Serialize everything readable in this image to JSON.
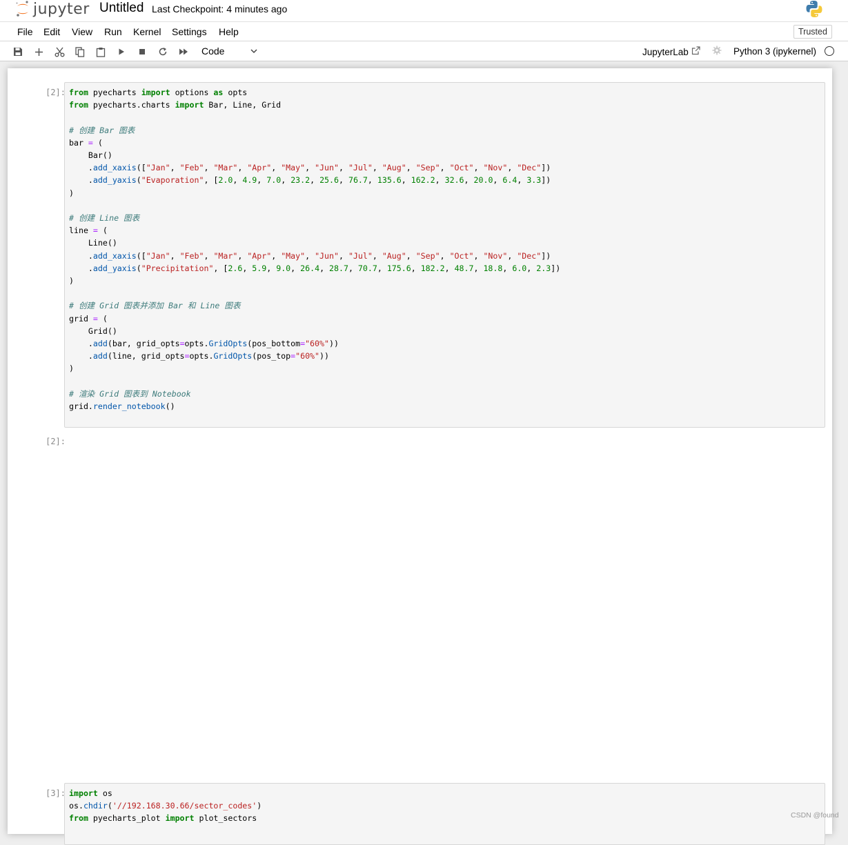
{
  "header": {
    "logo_text": "jupyter",
    "notebook_title": "Untitled",
    "checkpoint_label": "Last Checkpoint:",
    "checkpoint_time": "4 minutes ago"
  },
  "menubar": {
    "items": [
      "File",
      "Edit",
      "View",
      "Run",
      "Kernel",
      "Settings",
      "Help"
    ],
    "trusted_label": "Trusted"
  },
  "toolbar": {
    "icons": [
      "save-icon",
      "add-cell-icon",
      "cut-icon",
      "copy-icon",
      "paste-icon",
      "run-icon",
      "stop-icon",
      "restart-icon",
      "fast-forward-icon"
    ],
    "cell_type": "Code",
    "jupyterlab_label": "JupyterLab",
    "kernel_name": "Python 3 (ipykernel)"
  },
  "cells": [
    {
      "prompt": "[2]:",
      "lines": [
        [
          [
            "kw",
            "from"
          ],
          [
            "t",
            " pyecharts "
          ],
          [
            "kw",
            "import"
          ],
          [
            "t",
            " options "
          ],
          [
            "kw",
            "as"
          ],
          [
            "t",
            " opts"
          ]
        ],
        [
          [
            "kw",
            "from"
          ],
          [
            "t",
            " pyecharts.charts "
          ],
          [
            "kw",
            "import"
          ],
          [
            "t",
            " Bar, Line, Grid"
          ]
        ],
        [],
        [
          [
            "cm",
            "# 创建 Bar 图表"
          ]
        ],
        [
          [
            "t",
            "bar "
          ],
          [
            "op",
            "="
          ],
          [
            "t",
            " ("
          ]
        ],
        [
          [
            "t",
            "    Bar()"
          ]
        ],
        [
          [
            "t",
            "    ."
          ],
          [
            "fn",
            "add_xaxis"
          ],
          [
            "t",
            "(["
          ],
          [
            "st",
            "\"Jan\""
          ],
          [
            "t",
            ", "
          ],
          [
            "st",
            "\"Feb\""
          ],
          [
            "t",
            ", "
          ],
          [
            "st",
            "\"Mar\""
          ],
          [
            "t",
            ", "
          ],
          [
            "st",
            "\"Apr\""
          ],
          [
            "t",
            ", "
          ],
          [
            "st",
            "\"May\""
          ],
          [
            "t",
            ", "
          ],
          [
            "st",
            "\"Jun\""
          ],
          [
            "t",
            ", "
          ],
          [
            "st",
            "\"Jul\""
          ],
          [
            "t",
            ", "
          ],
          [
            "st",
            "\"Aug\""
          ],
          [
            "t",
            ", "
          ],
          [
            "st",
            "\"Sep\""
          ],
          [
            "t",
            ", "
          ],
          [
            "st",
            "\"Oct\""
          ],
          [
            "t",
            ", "
          ],
          [
            "st",
            "\"Nov\""
          ],
          [
            "t",
            ", "
          ],
          [
            "st",
            "\"Dec\""
          ],
          [
            "t",
            "])"
          ]
        ],
        [
          [
            "t",
            "    ."
          ],
          [
            "fn",
            "add_yaxis"
          ],
          [
            "t",
            "("
          ],
          [
            "st",
            "\"Evaporation\""
          ],
          [
            "t",
            ", ["
          ],
          [
            "nm",
            "2.0"
          ],
          [
            "t",
            ", "
          ],
          [
            "nm",
            "4.9"
          ],
          [
            "t",
            ", "
          ],
          [
            "nm",
            "7.0"
          ],
          [
            "t",
            ", "
          ],
          [
            "nm",
            "23.2"
          ],
          [
            "t",
            ", "
          ],
          [
            "nm",
            "25.6"
          ],
          [
            "t",
            ", "
          ],
          [
            "nm",
            "76.7"
          ],
          [
            "t",
            ", "
          ],
          [
            "nm",
            "135.6"
          ],
          [
            "t",
            ", "
          ],
          [
            "nm",
            "162.2"
          ],
          [
            "t",
            ", "
          ],
          [
            "nm",
            "32.6"
          ],
          [
            "t",
            ", "
          ],
          [
            "nm",
            "20.0"
          ],
          [
            "t",
            ", "
          ],
          [
            "nm",
            "6.4"
          ],
          [
            "t",
            ", "
          ],
          [
            "nm",
            "3.3"
          ],
          [
            "t",
            "])"
          ]
        ],
        [
          [
            "t",
            ")"
          ]
        ],
        [],
        [
          [
            "cm",
            "# 创建 Line 图表"
          ]
        ],
        [
          [
            "t",
            "line "
          ],
          [
            "op",
            "="
          ],
          [
            "t",
            " ("
          ]
        ],
        [
          [
            "t",
            "    Line()"
          ]
        ],
        [
          [
            "t",
            "    ."
          ],
          [
            "fn",
            "add_xaxis"
          ],
          [
            "t",
            "(["
          ],
          [
            "st",
            "\"Jan\""
          ],
          [
            "t",
            ", "
          ],
          [
            "st",
            "\"Feb\""
          ],
          [
            "t",
            ", "
          ],
          [
            "st",
            "\"Mar\""
          ],
          [
            "t",
            ", "
          ],
          [
            "st",
            "\"Apr\""
          ],
          [
            "t",
            ", "
          ],
          [
            "st",
            "\"May\""
          ],
          [
            "t",
            ", "
          ],
          [
            "st",
            "\"Jun\""
          ],
          [
            "t",
            ", "
          ],
          [
            "st",
            "\"Jul\""
          ],
          [
            "t",
            ", "
          ],
          [
            "st",
            "\"Aug\""
          ],
          [
            "t",
            ", "
          ],
          [
            "st",
            "\"Sep\""
          ],
          [
            "t",
            ", "
          ],
          [
            "st",
            "\"Oct\""
          ],
          [
            "t",
            ", "
          ],
          [
            "st",
            "\"Nov\""
          ],
          [
            "t",
            ", "
          ],
          [
            "st",
            "\"Dec\""
          ],
          [
            "t",
            "])"
          ]
        ],
        [
          [
            "t",
            "    ."
          ],
          [
            "fn",
            "add_yaxis"
          ],
          [
            "t",
            "("
          ],
          [
            "st",
            "\"Precipitation\""
          ],
          [
            "t",
            ", ["
          ],
          [
            "nm",
            "2.6"
          ],
          [
            "t",
            ", "
          ],
          [
            "nm",
            "5.9"
          ],
          [
            "t",
            ", "
          ],
          [
            "nm",
            "9.0"
          ],
          [
            "t",
            ", "
          ],
          [
            "nm",
            "26.4"
          ],
          [
            "t",
            ", "
          ],
          [
            "nm",
            "28.7"
          ],
          [
            "t",
            ", "
          ],
          [
            "nm",
            "70.7"
          ],
          [
            "t",
            ", "
          ],
          [
            "nm",
            "175.6"
          ],
          [
            "t",
            ", "
          ],
          [
            "nm",
            "182.2"
          ],
          [
            "t",
            ", "
          ],
          [
            "nm",
            "48.7"
          ],
          [
            "t",
            ", "
          ],
          [
            "nm",
            "18.8"
          ],
          [
            "t",
            ", "
          ],
          [
            "nm",
            "6.0"
          ],
          [
            "t",
            ", "
          ],
          [
            "nm",
            "2.3"
          ],
          [
            "t",
            "])"
          ]
        ],
        [
          [
            "t",
            ")"
          ]
        ],
        [],
        [
          [
            "cm",
            "# 创建 Grid 图表并添加 Bar 和 Line 图表"
          ]
        ],
        [
          [
            "t",
            "grid "
          ],
          [
            "op",
            "="
          ],
          [
            "t",
            " ("
          ]
        ],
        [
          [
            "t",
            "    Grid()"
          ]
        ],
        [
          [
            "t",
            "    ."
          ],
          [
            "fn",
            "add"
          ],
          [
            "t",
            "(bar, grid_opts"
          ],
          [
            "op",
            "="
          ],
          [
            "t",
            "opts."
          ],
          [
            "fn",
            "GridOpts"
          ],
          [
            "t",
            "(pos_bottom"
          ],
          [
            "op",
            "="
          ],
          [
            "st",
            "\"60%\""
          ],
          [
            "t",
            "))"
          ]
        ],
        [
          [
            "t",
            "    ."
          ],
          [
            "fn",
            "add"
          ],
          [
            "t",
            "(line, grid_opts"
          ],
          [
            "op",
            "="
          ],
          [
            "t",
            "opts."
          ],
          [
            "fn",
            "GridOpts"
          ],
          [
            "t",
            "(pos_top"
          ],
          [
            "op",
            "="
          ],
          [
            "st",
            "\"60%\""
          ],
          [
            "t",
            "))"
          ]
        ],
        [
          [
            "t",
            ")"
          ]
        ],
        [],
        [
          [
            "cm",
            "# 渲染 Grid 图表到 Notebook"
          ]
        ],
        [
          [
            "t",
            "grid."
          ],
          [
            "fn",
            "render_notebook"
          ],
          [
            "t",
            "()"
          ]
        ]
      ]
    },
    {
      "prompt": "[3]:",
      "lines": [
        [
          [
            "kw",
            "import"
          ],
          [
            "t",
            " os"
          ]
        ],
        [
          [
            "t",
            "os."
          ],
          [
            "fn",
            "chdir"
          ],
          [
            "t",
            "("
          ],
          [
            "st",
            "'//192.168.30.66/sector_codes'"
          ],
          [
            "t",
            ")"
          ]
        ],
        [
          [
            "kw",
            "from"
          ],
          [
            "t",
            " pyecharts_plot "
          ],
          [
            "kw",
            "import"
          ],
          [
            "t",
            " plot_sectors"
          ]
        ]
      ]
    }
  ],
  "output_prompt": "[2]:",
  "watermark": "CSDN @found"
}
